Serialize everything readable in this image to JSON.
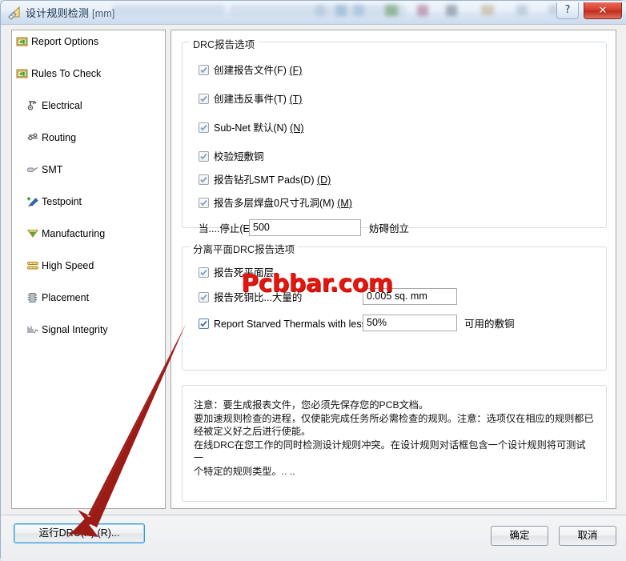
{
  "window": {
    "title": "设计规则检测",
    "unit": "[mm]",
    "icon": "ruler-triangle-icon",
    "help_label": "?",
    "close_label": "✕",
    "help_icon": "help-icon",
    "close_icon": "close-icon"
  },
  "tree": {
    "items": [
      {
        "label": "Report Options",
        "icon": "report-options-icon",
        "level": 0
      },
      {
        "label": "Rules To Check",
        "icon": "rules-to-check-icon",
        "level": 0
      },
      {
        "label": "Electrical",
        "icon": "electrical-icon",
        "level": 1
      },
      {
        "label": "Routing",
        "icon": "routing-icon",
        "level": 1
      },
      {
        "label": "SMT",
        "icon": "smt-icon",
        "level": 1
      },
      {
        "label": "Testpoint",
        "icon": "testpoint-icon",
        "level": 1
      },
      {
        "label": "Manufacturing",
        "icon": "manufacturing-icon",
        "level": 1
      },
      {
        "label": "High Speed",
        "icon": "high-speed-icon",
        "level": 1
      },
      {
        "label": "Placement",
        "icon": "placement-icon",
        "level": 1
      },
      {
        "label": "Signal Integrity",
        "icon": "signal-integrity-icon",
        "level": 1
      }
    ]
  },
  "drc_report_group": {
    "title": "DRC报告选项",
    "options": [
      {
        "label": "创建报告文件(F)",
        "mnemonic": "(F)",
        "checked": true,
        "enabled": false
      },
      {
        "label": "创建违反事件(T)",
        "mnemonic": "(T)",
        "checked": true,
        "enabled": false
      },
      {
        "label": "Sub-Net 默认(N)",
        "mnemonic": "(N)",
        "checked": true,
        "enabled": false
      },
      {
        "label": "校验短敷铜",
        "mnemonic": "",
        "checked": true,
        "enabled": false
      },
      {
        "label": "报告钻孔SMT Pads(D)",
        "mnemonic": "(D)",
        "checked": true,
        "enabled": false
      },
      {
        "label": "报告多层焊盘0尺寸孔洞(M)",
        "mnemonic": "(M)",
        "checked": true,
        "enabled": false
      }
    ],
    "stop_row": {
      "label": "当....停止(E",
      "value": "500",
      "suffix": "妨碍创立"
    }
  },
  "split_plane_group": {
    "title": "分离平面DRC报告选项",
    "options": [
      {
        "label": "报告死平面层.",
        "checked": true,
        "enabled": false
      },
      {
        "label": "报告死铜比...大量的",
        "checked": true,
        "enabled": false,
        "value": "0.005 sq. mm",
        "suffix": ""
      },
      {
        "label": "Report Starved Thermals with less than",
        "checked": true,
        "enabled": true,
        "value": "50%",
        "suffix": "可用的敷铜"
      }
    ]
  },
  "note": {
    "lines": [
      "注意：要生成报表文件，您必须先保存您的PCB文档。",
      "要加速规则检查的进程，仅使能完成任务所必需检查的规则。注意：选项仅在相应的规则都已",
      "经被定义好之后进行使能。",
      "在线DRC在您工作的同时检测设计规则冲突。在设计规则对话框包含一个设计规则将可测试一",
      "个特定的规则类型。.. .."
    ]
  },
  "footer": {
    "run_drc_label": "运行DRC(R) (R)...",
    "ok_label": "确定",
    "cancel_label": "取消"
  },
  "watermark": {
    "text": "Pcbbar.com",
    "color": "#e2160f"
  },
  "annotation": {
    "arrow_color": "#9b1b17",
    "arrow_name": "callout-arrow"
  }
}
